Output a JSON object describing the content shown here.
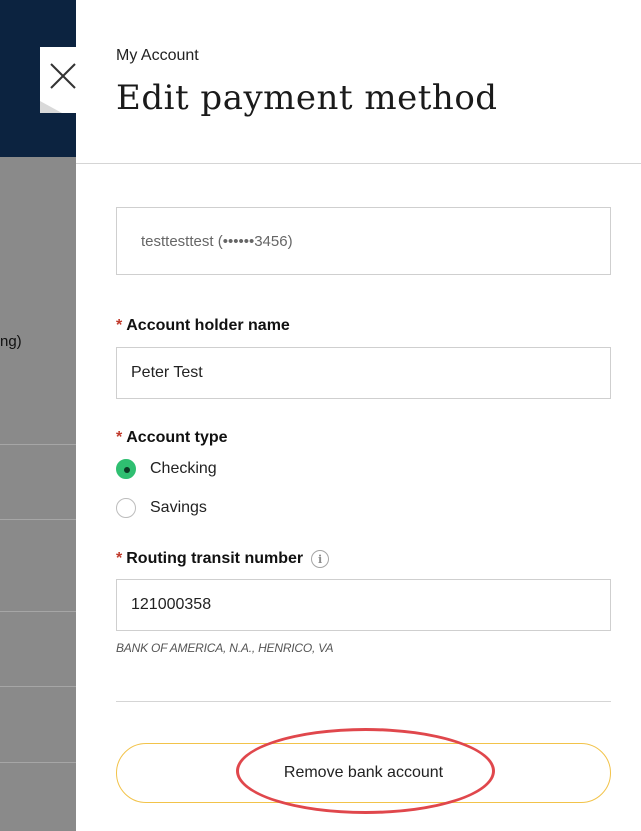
{
  "background": {
    "partial_text": "ng)"
  },
  "panel": {
    "eyebrow": "My Account",
    "title": "Edit payment method",
    "account_display": "testtesttest (••••••3456)",
    "account_holder": {
      "required_mark": "*",
      "label": "Account holder name",
      "value": "Peter Test"
    },
    "account_type": {
      "required_mark": "*",
      "label": "Account type",
      "options": [
        {
          "label": "Checking",
          "selected": true
        },
        {
          "label": "Savings",
          "selected": false
        }
      ]
    },
    "routing": {
      "required_mark": "*",
      "label": "Routing transit number",
      "info_glyph": "i",
      "value": "121000358",
      "bank_name": "BANK OF AMERICA, N.A., HENRICO, VA"
    },
    "remove_label": "Remove bank account"
  },
  "colors": {
    "header_navy": "#0c2340",
    "radio_selected": "#2fbf71",
    "button_border": "#f2c34a",
    "required_star": "#c0392b",
    "annotation_ring": "#e0474c"
  },
  "icons": {
    "close": "close-icon",
    "info": "info-icon"
  }
}
